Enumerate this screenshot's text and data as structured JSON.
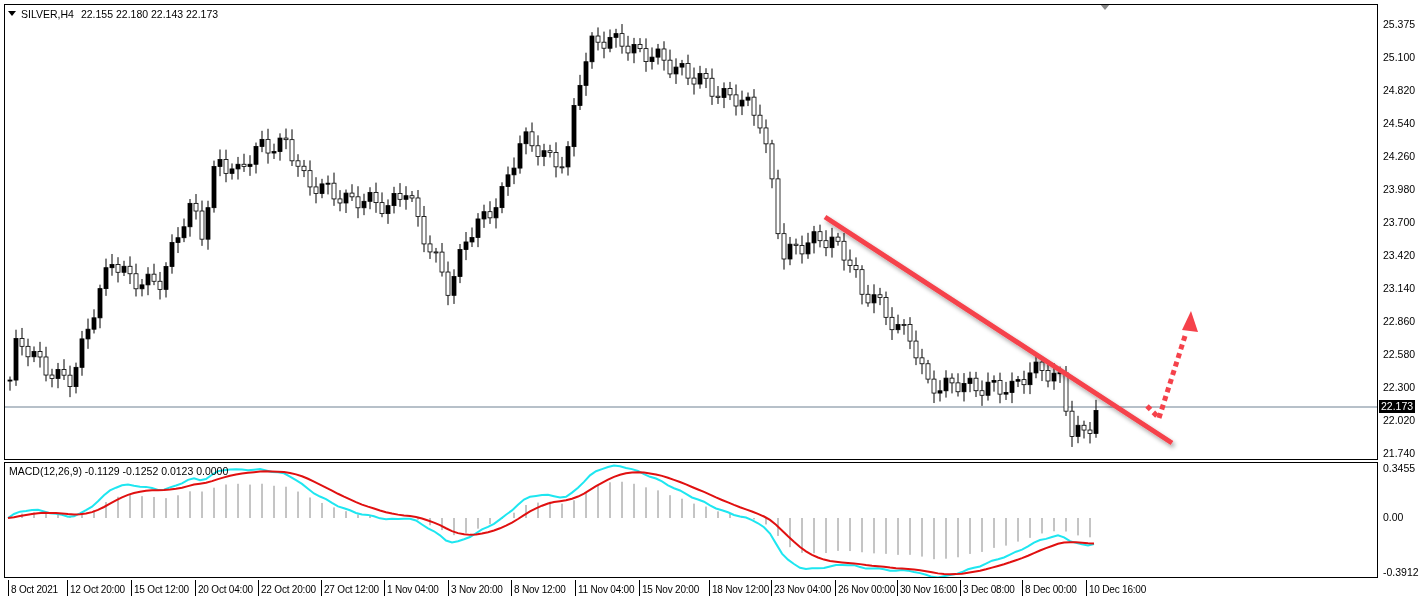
{
  "header": {
    "symbol": "SILVER,H4",
    "quote": "22.155 22.180 22.143 22.173"
  },
  "price_axis": {
    "ticks": [
      "25.375",
      "25.100",
      "24.820",
      "24.540",
      "24.260",
      "23.980",
      "23.700",
      "23.420",
      "23.140",
      "22.860",
      "22.580",
      "22.300",
      "22.020",
      "21.740"
    ],
    "current_price": "22.173"
  },
  "macd": {
    "label": "MACD(12,26,9) -0.1129 -0.1252 0.0123 0.0000",
    "ticks": [
      "0.3455",
      "0.00",
      "-0.3912"
    ]
  },
  "time_axis": {
    "ticks": [
      "8 Oct 2021",
      "12 Oct 20:00",
      "15 Oct 12:00",
      "20 Oct 04:00",
      "22 Oct 20:00",
      "27 Oct 12:00",
      "1 Nov 04:00",
      "3 Nov 20:00",
      "8 Nov 12:00",
      "11 Nov 04:00",
      "15 Nov 20:00",
      "18 Nov 12:00",
      "23 Nov 04:00",
      "26 Nov 00:00",
      "30 Nov 16:00",
      "3 Dec 08:00",
      "8 Dec 00:00",
      "10 Dec 16:00"
    ]
  }
}
